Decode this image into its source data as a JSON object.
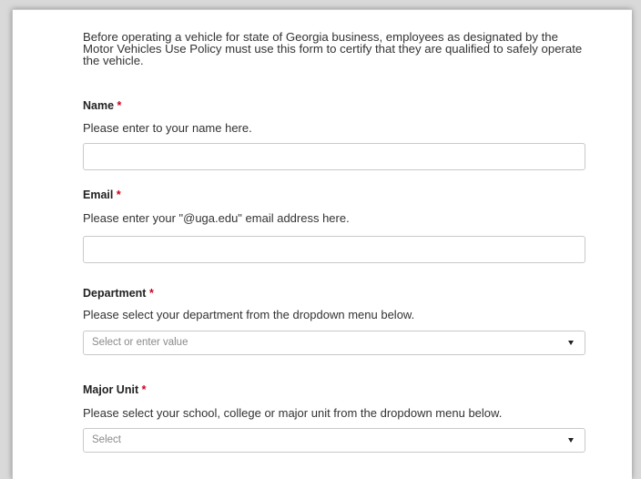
{
  "form": {
    "intro": "Before operating a vehicle for state of Georgia business, employees as designated by the Motor Vehicles Use Policy must use this form to certify that they are qualified to safely operate the vehicle.",
    "required_marker": "*",
    "name": {
      "label": "Name",
      "help": "Please enter to your name here.",
      "value": ""
    },
    "email": {
      "label": "Email",
      "help": "Please enter your \"@uga.edu\" email address here.",
      "value": ""
    },
    "department": {
      "label": "Department",
      "help": "Please select your department from the dropdown menu below.",
      "placeholder": "Select or enter value"
    },
    "major_unit": {
      "label": "Major Unit",
      "help": "Please select your school, college or major unit from the dropdown menu below.",
      "placeholder": "Select"
    }
  },
  "colors": {
    "required": "#d0021b",
    "placeholder": "#8a8a8a",
    "border": "#c9c9c9"
  }
}
